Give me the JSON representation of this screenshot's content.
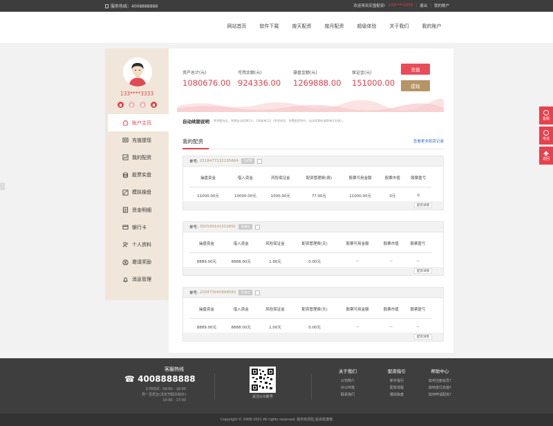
{
  "topbar": {
    "hotline": "服务热线：4008888888",
    "welcome": "欢迎来到实盘配资!",
    "user": "133****3333",
    "logout": "退出",
    "account": "我的账户"
  },
  "nav": {
    "items": [
      "网站首页",
      "软件下载",
      "按天配资",
      "按月配资",
      "超级体验",
      "关于我们",
      "我的账户"
    ]
  },
  "sidebar": {
    "username": "133****3333",
    "menu": [
      "账户主页",
      "充值提现",
      "我的配资",
      "股票实盘",
      "模拟操盘",
      "资金明细",
      "银行卡",
      "个人资料",
      "邀请奖励",
      "消息管理"
    ]
  },
  "stats": [
    {
      "label": "资产总计(元)",
      "value": "1080676.00"
    },
    {
      "label": "可用余额(元)",
      "value": "924336.00"
    },
    {
      "label": "操盘金额(元)",
      "value": "1269888.00"
    },
    {
      "label": "保证金(元)",
      "value": "151000.00"
    }
  ],
  "buttons": {
    "charge": "充值",
    "withdraw": "提现"
  },
  "auto": {
    "title": "自动续期说明",
    "desc": "将余额充足，到期自动续期1天，1周或单1月（免息体验、免费配资除外，自动续期仅收取每天利息）。"
  },
  "section": {
    "title": "我的配资",
    "more": "查看更多配资记录"
  },
  "order_headers": [
    "操盘资金",
    "借入资金",
    "风险保证金",
    "配资管理费(周)",
    "股票可用金额",
    "股票市值",
    "股票盈亏"
  ],
  "order_headers_day": [
    "操盘资金",
    "借入资金",
    "风险保证金",
    "配资管理费(天)",
    "股票可用金额",
    "股票市值",
    "股票盈亏"
  ],
  "orders": [
    {
      "no_label": "单号:",
      "no": "2518477132155864",
      "tag": "已结算",
      "cells": [
        "11000.00元",
        "10000.00元",
        "1000.00元",
        "77.00元",
        "11000.00元",
        "0元",
        "0"
      ],
      "detail": "配资详情"
    },
    {
      "no_label": "单号:",
      "no": "350599141552891",
      "tag": "未通过",
      "cells": [
        "8889.00元",
        "8888.00元",
        "1.00元",
        "0.00元",
        "--",
        "--",
        "--"
      ],
      "detail": "配资详情"
    },
    {
      "no_label": "单号:",
      "no": "203473045868582",
      "tag": "未通过",
      "cells": [
        "8889.00元",
        "8888.00元",
        "1.00元",
        "0.00元",
        "--",
        "--",
        "--"
      ],
      "detail": "配资详情"
    }
  ],
  "float": {
    "service": "客服",
    "phone": "电话",
    "top": "返回"
  },
  "footer": {
    "kf_title": "客服热线",
    "phone": "4008888888",
    "hours1": "工作时间：09:00 - 18:00",
    "hours2": "周一至周五(法定节假日除外)",
    "hours3": "10:00 - 17:00",
    "qr_text": "关注公众账号",
    "cols": [
      {
        "title": "关于我们",
        "links": [
          "公司简介",
          "办公环境",
          "联系我们"
        ]
      },
      {
        "title": "配资指引",
        "links": [
          "新手指引",
          "配资流程",
          "模拟操盘"
        ]
      },
      {
        "title": "帮助中心",
        "links": [
          "如何注册会员?",
          "如何进行充值?",
          "如何申请配资?"
        ]
      }
    ],
    "copyright": "Copyright © 2008-2021 All rights reserved.     股市有风险,投资需谨慎"
  },
  "colors": {
    "accent": "#e5404a",
    "gold": "#b59467",
    "sidebar": "#f0e7da"
  }
}
